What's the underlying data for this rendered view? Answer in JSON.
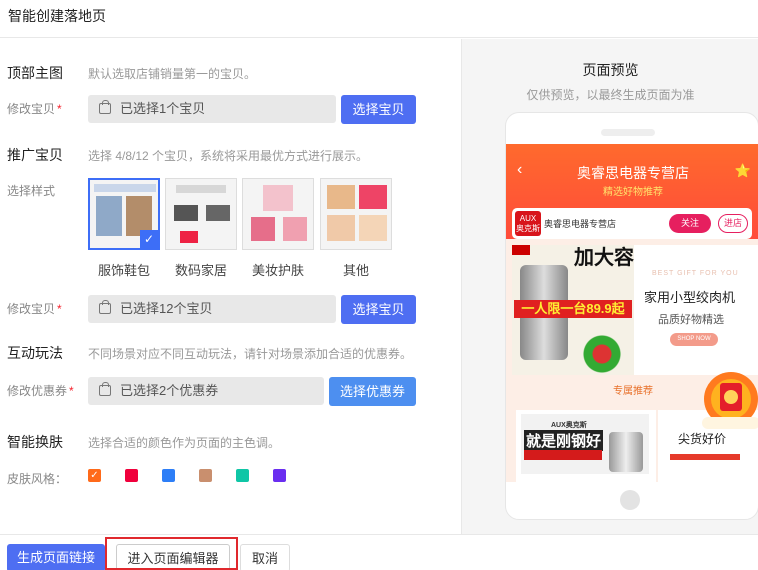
{
  "window": {
    "title": "智能创建落地页"
  },
  "top_image": {
    "title": "顶部主图",
    "desc": "默认选取店铺销量第一的宝贝。",
    "modify_label": "修改宝贝",
    "required_mark": "*",
    "selected_text": "已选择1个宝贝",
    "button_label": "选择宝贝"
  },
  "promo": {
    "title": "推广宝贝",
    "desc": "选择 4/8/12 个宝贝，系统将采用最优方式进行展示。",
    "style_label": "选择样式",
    "styles": [
      {
        "name": "服饰鞋包",
        "selected": true
      },
      {
        "name": "数码家居",
        "selected": false
      },
      {
        "name": "美妆护肤",
        "selected": false
      },
      {
        "name": "其他",
        "selected": false
      }
    ],
    "check_mark": "✓",
    "modify_label": "修改宝贝",
    "required_mark": "*",
    "selected_text": "已选择12个宝贝",
    "button_label": "选择宝贝"
  },
  "interactive": {
    "title": "互动玩法",
    "desc": "不同场景对应不同互动玩法，请针对场景添加合适的优惠券。",
    "coupon_label": "修改优惠券",
    "required_mark": "*",
    "selected_text": "已选择2个优惠券",
    "button_label": "选择优惠券"
  },
  "skin": {
    "title": "智能换肤",
    "desc": "选择合适的颜色作为页面的主色调。",
    "label": "皮肤风格：",
    "colors": [
      "#ff6a1a",
      "#f0003c",
      "#2d7ef7",
      "#c98f6e",
      "#0fc6a6",
      "#6a2ef0"
    ],
    "selected_index": 0
  },
  "preview": {
    "title": "页面预览",
    "subtitle": "仅供预览，以最终生成页面为准",
    "store_name": "奥睿思电器专营店",
    "slogan": "精选好物推荐",
    "shop_logo": "AUX 奥克斯",
    "shop_name": "奥睿思电器专营店",
    "follow_label": "关注",
    "enter_label": "进店",
    "banner_big": "加大容",
    "banner_red": "一人限一台89.9起",
    "banner_en": "BEST GIFT FOR YOU",
    "banner_h1": "家用小型绞肉机",
    "banner_h2": "品质好物精选",
    "banner_shop": "SHOP NOW",
    "rec_label": "专属推荐",
    "card1_brand": "AUX奥克斯",
    "card1_big": "就是刚钢好",
    "card2_title": "尖货好价"
  },
  "footer": {
    "generate_label": "生成页面链接",
    "editor_label": "进入页面编辑器",
    "cancel_label": "取消"
  }
}
